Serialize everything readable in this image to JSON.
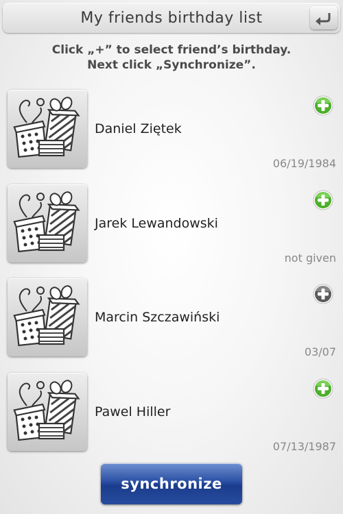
{
  "header": {
    "title": "My friends birthday list"
  },
  "instructions": {
    "line1": "Click „+” to select friend’s birthday.",
    "line2": "Next click „Synchronize”."
  },
  "friends": [
    {
      "name": "Daniel Ziętek",
      "date": "06/19/1984",
      "selected": true
    },
    {
      "name": "Jarek Lewandowski",
      "date": "not given",
      "selected": true
    },
    {
      "name": "Marcin Szczawiński",
      "date": "03/07",
      "selected": false
    },
    {
      "name": "Pawel Hiller",
      "date": "07/13/1987",
      "selected": true
    }
  ],
  "sync_button": {
    "label": "synchronize"
  },
  "colors": {
    "selected_plus": "#4caf2a",
    "unselected_plus": "#5a5a5a",
    "sync_button": "#23479c"
  },
  "icons": {
    "back": "back-arrow-icon",
    "gift": "gift-boxes-icon",
    "plus": "plus-circle-icon"
  }
}
